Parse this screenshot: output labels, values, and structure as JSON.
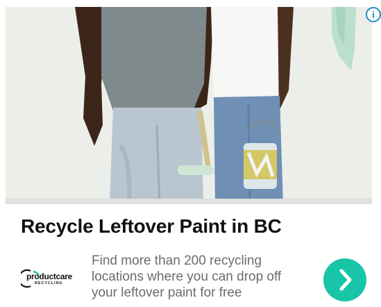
{
  "ad": {
    "info_glyph": "i",
    "headline": "Recycle Leftover Paint in BC",
    "description_lines": [
      "Find more than 200 recycling",
      "locations where you can drop off",
      "your leftover paint for free"
    ],
    "logo": {
      "brand": "productcare",
      "sub": "RECYCLING"
    },
    "cta_icon": "chevron-right-icon"
  },
  "colors": {
    "accent": "#19c5a7",
    "info": "#1a8fc0",
    "logo_accent": "#1ab394"
  }
}
